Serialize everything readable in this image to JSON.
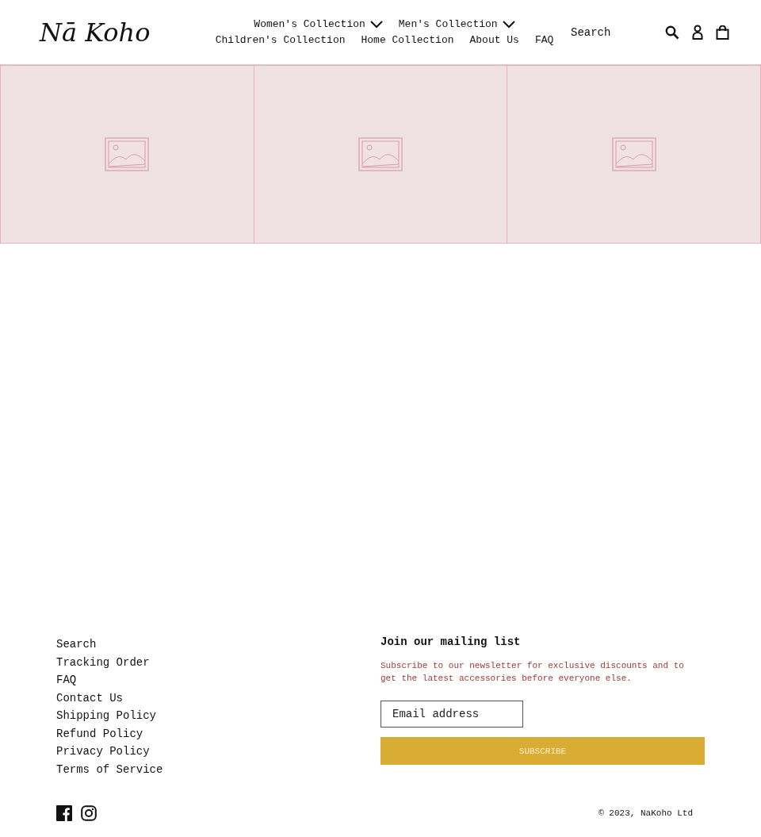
{
  "logo": "Nā Koho",
  "nav": [
    {
      "label": "Women's Collection",
      "dropdown": true
    },
    {
      "label": "Men's Collection",
      "dropdown": true
    },
    {
      "label": "Children's Collection",
      "dropdown": false
    },
    {
      "label": "Home Collection",
      "dropdown": false
    },
    {
      "label": "About Us",
      "dropdown": false
    },
    {
      "label": "FAQ",
      "dropdown": false
    }
  ],
  "search": {
    "placeholder": "Search"
  },
  "tiles": [
    {
      "kind": "placeholder"
    },
    {
      "kind": "placeholder"
    },
    {
      "kind": "placeholder"
    }
  ],
  "footer_links": [
    "Search",
    "Tracking Order",
    "FAQ",
    "Contact Us",
    "Shipping Policy",
    "Refund Policy",
    "Privacy Policy",
    "Terms of Service"
  ],
  "newsletter": {
    "title": "Join our mailing list",
    "text": "Subscribe to our newsletter for exclusive discounts and to get the latest accessories before everyone else.",
    "email_placeholder": "Email address",
    "button": "SUBSCRIBE"
  },
  "copyright": {
    "text": "© 2023,",
    "link": "NaKoho Ltd"
  }
}
